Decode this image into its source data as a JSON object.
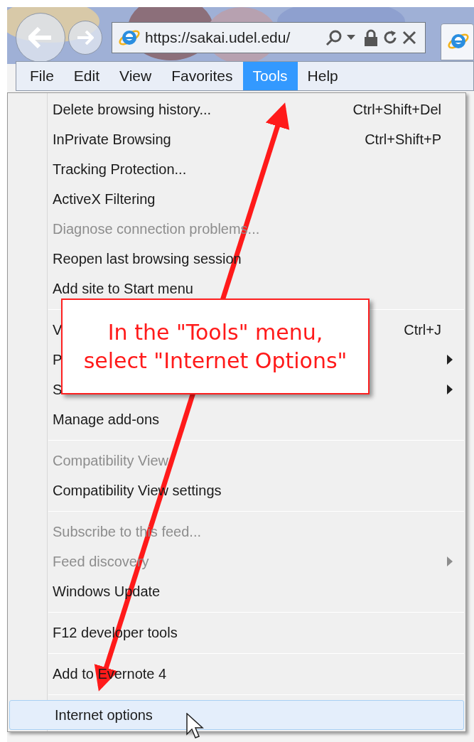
{
  "address_bar": {
    "url": "https://sakai.udel.edu/"
  },
  "menu_bar": [
    {
      "label": "File",
      "selected": false
    },
    {
      "label": "Edit",
      "selected": false
    },
    {
      "label": "View",
      "selected": false
    },
    {
      "label": "Favorites",
      "selected": false
    },
    {
      "label": "Tools",
      "selected": true
    },
    {
      "label": "Help",
      "selected": false
    }
  ],
  "tools_menu": {
    "groups": [
      [
        {
          "label": "Delete browsing history...",
          "shortcut": "Ctrl+Shift+Del",
          "disabled": false,
          "has_submenu": false,
          "selected": false
        },
        {
          "label": "InPrivate Browsing",
          "shortcut": "Ctrl+Shift+P",
          "disabled": false,
          "has_submenu": false,
          "selected": false
        },
        {
          "label": "Tracking Protection...",
          "disabled": false,
          "has_submenu": false,
          "selected": false
        },
        {
          "label": "ActiveX Filtering",
          "disabled": false,
          "has_submenu": false,
          "selected": false
        },
        {
          "label": "Diagnose connection problems...",
          "disabled": true,
          "has_submenu": false,
          "selected": false
        },
        {
          "label": "Reopen last browsing session",
          "disabled": false,
          "has_submenu": false,
          "selected": false
        },
        {
          "label": "Add site to Start menu",
          "disabled": false,
          "has_submenu": false,
          "selected": false
        }
      ],
      [
        {
          "label": "V",
          "shortcut": "Ctrl+J",
          "disabled": false,
          "has_submenu": false,
          "selected": false
        },
        {
          "label": "P",
          "disabled": false,
          "has_submenu": true,
          "selected": false
        },
        {
          "label": "S",
          "disabled": false,
          "has_submenu": true,
          "selected": false
        },
        {
          "label": "Manage add-ons",
          "disabled": false,
          "has_submenu": false,
          "selected": false
        }
      ],
      [
        {
          "label": "Compatibility View",
          "disabled": true,
          "has_submenu": false,
          "selected": false
        },
        {
          "label": "Compatibility View settings",
          "disabled": false,
          "has_submenu": false,
          "selected": false
        }
      ],
      [
        {
          "label": "Subscribe to this feed...",
          "disabled": true,
          "has_submenu": false,
          "selected": false
        },
        {
          "label": "Feed discovery",
          "disabled": true,
          "has_submenu": true,
          "selected": false
        },
        {
          "label": "Windows Update",
          "disabled": false,
          "has_submenu": false,
          "selected": false
        }
      ],
      [
        {
          "label": "F12 developer tools",
          "disabled": false,
          "has_submenu": false,
          "selected": false
        }
      ],
      [
        {
          "label": "Add to Evernote 4",
          "disabled": false,
          "has_submenu": false,
          "selected": false
        }
      ],
      [
        {
          "label": "Internet options",
          "disabled": false,
          "has_submenu": false,
          "selected": true
        }
      ]
    ]
  },
  "callout": {
    "lines": [
      "In the \"Tools\" menu,",
      "select \"Internet Options\""
    ]
  }
}
